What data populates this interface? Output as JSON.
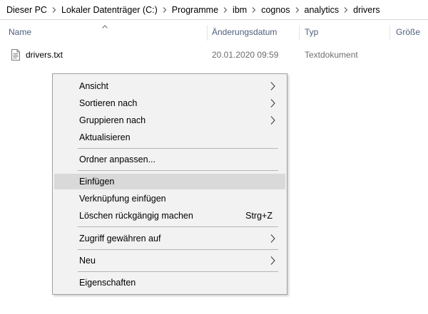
{
  "breadcrumb": {
    "items": [
      "Dieser PC",
      "Lokaler Datenträger (C:)",
      "Programme",
      "ibm",
      "cognos",
      "analytics",
      "drivers"
    ]
  },
  "columns": {
    "name": "Name",
    "date": "Änderungsdatum",
    "type": "Typ",
    "size": "Größe"
  },
  "files": [
    {
      "name": "drivers.txt",
      "date": "20.01.2020 09:59",
      "type": "Textdokument"
    }
  ],
  "context_menu": {
    "view": "Ansicht",
    "sort_by": "Sortieren nach",
    "group_by": "Gruppieren nach",
    "refresh": "Aktualisieren",
    "customize_folder": "Ordner anpassen...",
    "paste": "Einfügen",
    "paste_shortcut": "Verknüpfung einfügen",
    "undo_delete": "Löschen rückgängig machen",
    "undo_delete_key": "Strg+Z",
    "give_access": "Zugriff gewähren auf",
    "new": "Neu",
    "properties": "Eigenschaften"
  },
  "colors": {
    "header_text": "#4c607a",
    "meta_text": "#6d6d6d",
    "menu_bg": "#f2f2f2",
    "menu_highlight": "#d9d9d9",
    "menu_border": "#a0a0a0"
  }
}
